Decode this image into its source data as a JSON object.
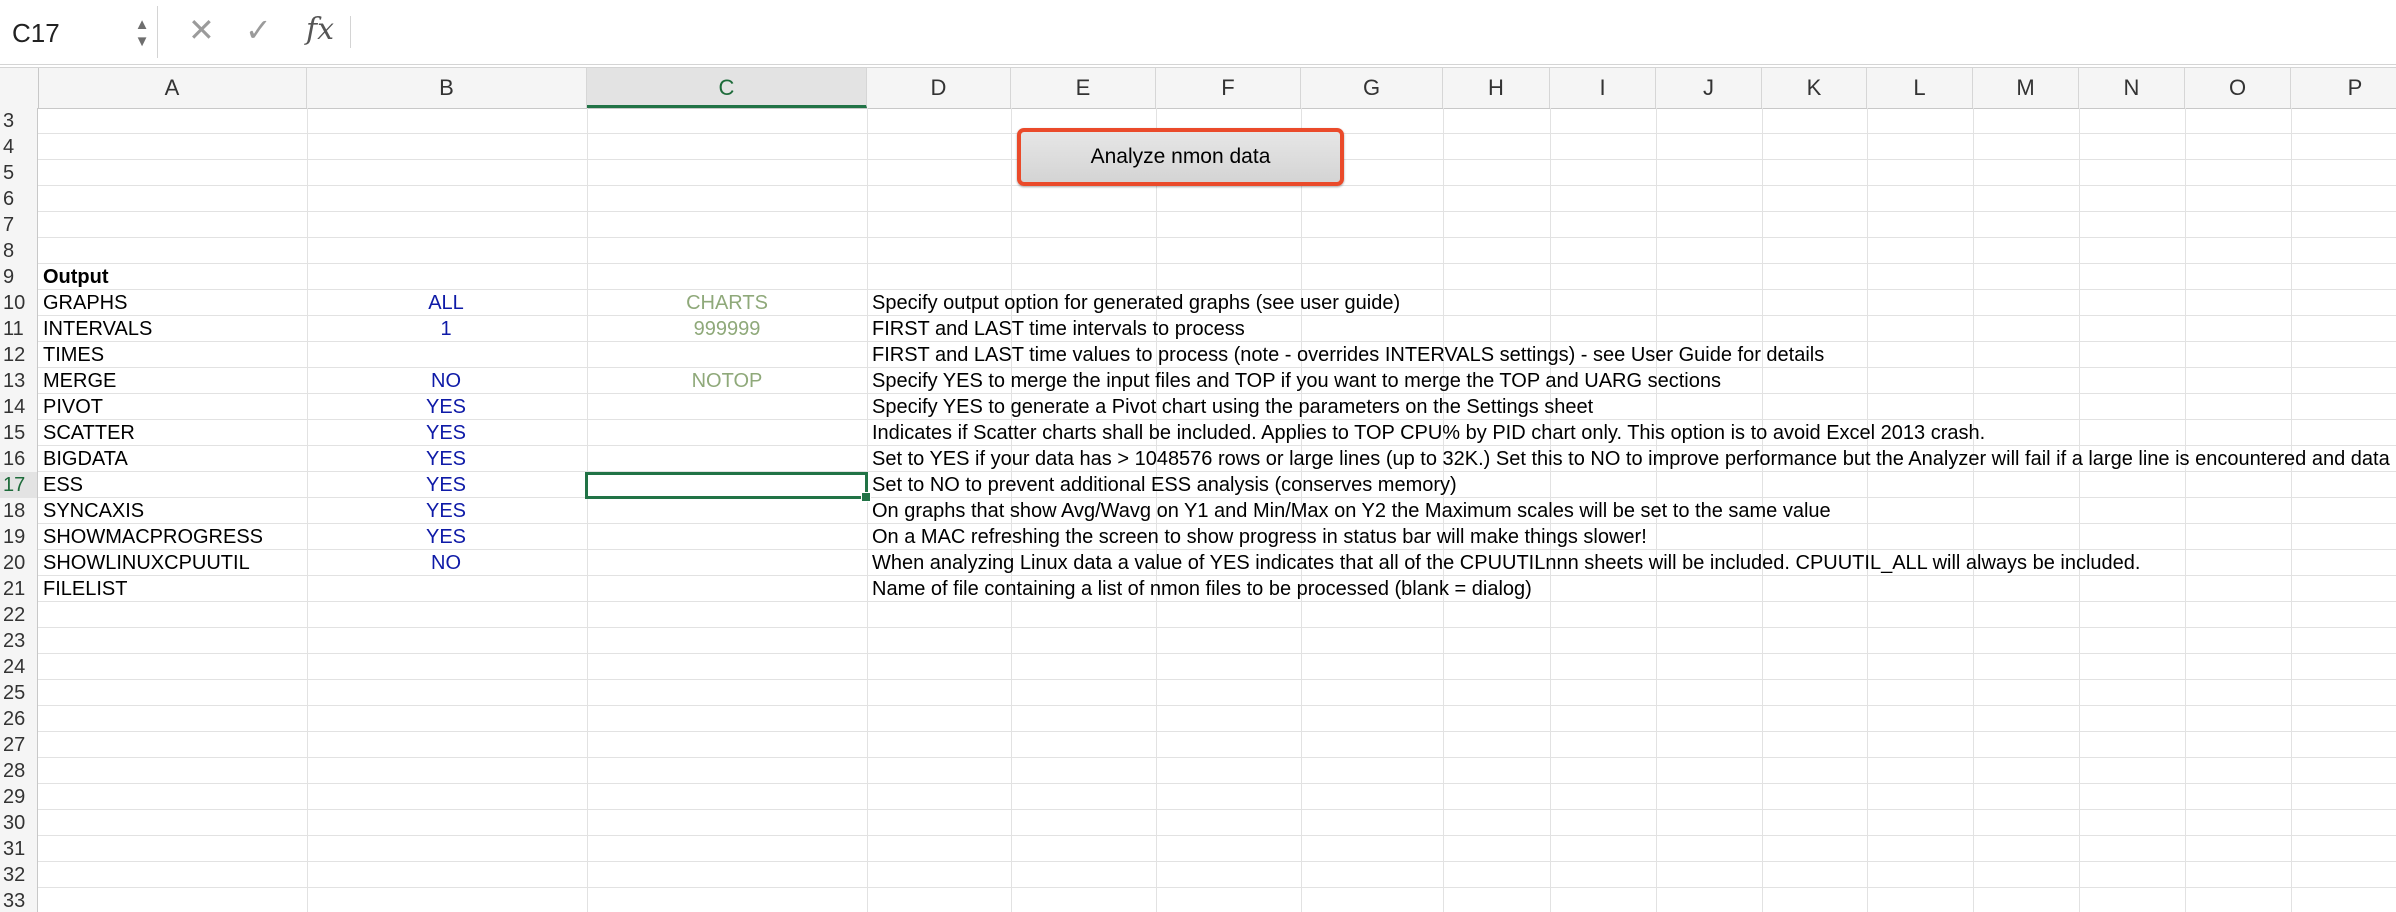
{
  "formula_bar": {
    "name_box": "C17",
    "stepper_up": "▲",
    "stepper_down": "▼",
    "cancel_glyph": "✕",
    "enter_glyph": "✓",
    "fx_label": "fx",
    "formula_value": ""
  },
  "columns": [
    "A",
    "B",
    "C",
    "D",
    "E",
    "F",
    "G",
    "H",
    "I",
    "J",
    "K",
    "L",
    "M",
    "N",
    "O",
    "P"
  ],
  "active_column": "C",
  "active_row": "17",
  "rows": [
    {
      "num": "3",
      "a": "",
      "b": "",
      "c": "",
      "d": ""
    },
    {
      "num": "4",
      "a": "",
      "b": "",
      "c": "",
      "d": ""
    },
    {
      "num": "5",
      "a": "",
      "b": "",
      "c": "",
      "d": ""
    },
    {
      "num": "6",
      "a": "",
      "b": "",
      "c": "",
      "d": ""
    },
    {
      "num": "7",
      "a": "",
      "b": "",
      "c": "",
      "d": ""
    },
    {
      "num": "8",
      "a": "",
      "b": "",
      "c": "",
      "d": ""
    },
    {
      "num": "9",
      "a": "Output",
      "b": "",
      "c": "",
      "d": "",
      "a_bold": true
    },
    {
      "num": "10",
      "a": "GRAPHS",
      "b": "ALL",
      "c": "CHARTS",
      "d": "Specify output option for generated graphs (see user guide)"
    },
    {
      "num": "11",
      "a": "INTERVALS",
      "b": "1",
      "c": "999999",
      "d": "FIRST and LAST time intervals to process"
    },
    {
      "num": "12",
      "a": "TIMES",
      "b": "",
      "c": "",
      "d": "FIRST and LAST time values to process (note - overrides INTERVALS settings) - see User Guide for details"
    },
    {
      "num": "13",
      "a": "MERGE",
      "b": "NO",
      "c": "NOTOP",
      "d": "Specify YES to merge the input files and TOP if you want to merge the TOP and UARG sections"
    },
    {
      "num": "14",
      "a": "PIVOT",
      "b": "YES",
      "c": "",
      "d": "Specify YES to generate a Pivot chart using the parameters on the Settings sheet"
    },
    {
      "num": "15",
      "a": "SCATTER",
      "b": "YES",
      "c": "",
      "d": "Indicates if Scatter charts shall be included.  Applies to TOP CPU% by PID chart only.  This option is to avoid Excel 2013 crash."
    },
    {
      "num": "16",
      "a": "BIGDATA",
      "b": "YES",
      "c": "",
      "d": "Set to YES if your data has > 1048576 rows or large lines (up to 32K.)  Set this to NO to improve performance but the Analyzer will fail if a large line is encountered and data"
    },
    {
      "num": "17",
      "a": "ESS",
      "b": "YES",
      "c": "",
      "d": "Set to NO to prevent additional ESS analysis (conserves memory)"
    },
    {
      "num": "18",
      "a": "SYNCAXIS",
      "b": "YES",
      "c": "",
      "d": "On graphs that show Avg/Wavg on Y1 and Min/Max on Y2 the Maximum scales will be set to the same value"
    },
    {
      "num": "19",
      "a": "SHOWMACPROGRESS",
      "b": "YES",
      "c": "",
      "d": "On a MAC refreshing the screen to show progress in status bar will make things slower!"
    },
    {
      "num": "20",
      "a": "SHOWLINUXCPUUTIL",
      "b": "NO",
      "c": "",
      "d": "When analyzing Linux data a value of YES indicates that all of the CPUUTILnnn sheets will be included.  CPUUTIL_ALL will always be included."
    },
    {
      "num": "21",
      "a": "FILELIST",
      "b": "",
      "c": "",
      "d": "Name of file containing a list of nmon files to be processed (blank = dialog)"
    },
    {
      "num": "22",
      "a": "",
      "b": "",
      "c": "",
      "d": ""
    },
    {
      "num": "23",
      "a": "",
      "b": "",
      "c": "",
      "d": ""
    },
    {
      "num": "24",
      "a": "",
      "b": "",
      "c": "",
      "d": ""
    },
    {
      "num": "25",
      "a": "",
      "b": "",
      "c": "",
      "d": ""
    },
    {
      "num": "26",
      "a": "",
      "b": "",
      "c": "",
      "d": ""
    },
    {
      "num": "27",
      "a": "",
      "b": "",
      "c": "",
      "d": ""
    },
    {
      "num": "28",
      "a": "",
      "b": "",
      "c": "",
      "d": ""
    },
    {
      "num": "29",
      "a": "",
      "b": "",
      "c": "",
      "d": ""
    },
    {
      "num": "30",
      "a": "",
      "b": "",
      "c": "",
      "d": ""
    },
    {
      "num": "31",
      "a": "",
      "b": "",
      "c": "",
      "d": ""
    },
    {
      "num": "32",
      "a": "",
      "b": "",
      "c": "",
      "d": ""
    },
    {
      "num": "33",
      "a": "",
      "b": "",
      "c": "",
      "d": ""
    }
  ],
  "macro_button": {
    "label": "Analyze nmon data"
  },
  "colors": {
    "selection": "#217346",
    "button_highlight": "#ea4a2a",
    "value_blue": "#0e1aa7",
    "value_green": "#8fa97a"
  }
}
